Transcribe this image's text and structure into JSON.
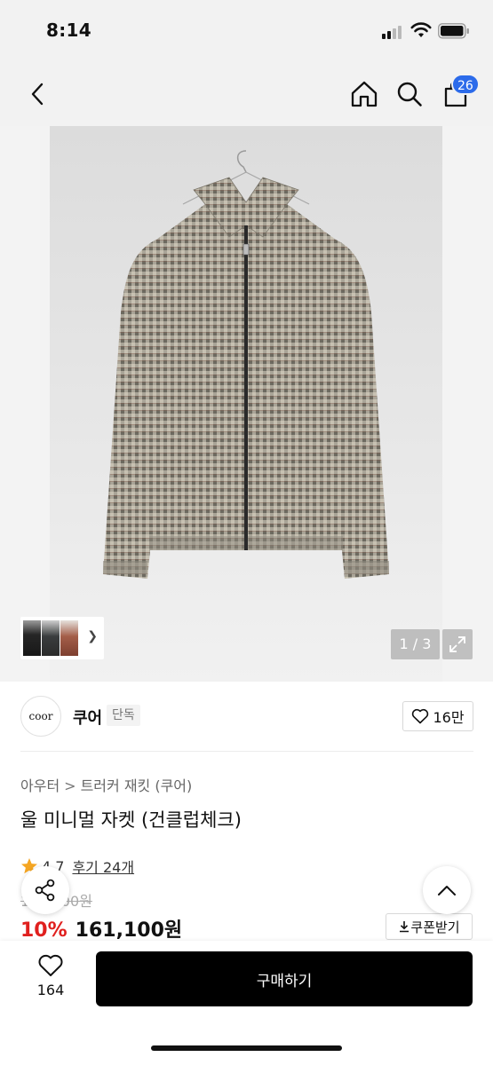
{
  "status_bar": {
    "time": "8:14"
  },
  "nav": {
    "cart_count": "26"
  },
  "gallery": {
    "page_indicator": "1 / 3"
  },
  "brand": {
    "logo_text": "coor",
    "name": "쿠어",
    "badge": "단독",
    "like_count": "16만"
  },
  "breadcrumb": {
    "category": "아우터",
    "subcategory": "트러커 재킷 (쿠어)"
  },
  "product": {
    "title": "울 미니멀 자켓 (건클럽체크)",
    "rating": "4.7",
    "reviews": "후기 24개",
    "original_price": "179,000원",
    "discount": "10%",
    "sale_price": "161,100원",
    "coupon_label": "쿠폰받기"
  },
  "bottom_bar": {
    "wish_count": "164",
    "buy_label": "구매하기"
  },
  "colors": {
    "accent": "#2c6bea",
    "discount_red": "#e0201e",
    "star": "#f5a623"
  },
  "icons": [
    "back-icon",
    "home-icon",
    "search-icon",
    "cart-icon",
    "chevron-right-icon",
    "expand-icon",
    "heart-icon",
    "star-icon",
    "share-icon",
    "chevron-up-icon",
    "download-icon"
  ]
}
